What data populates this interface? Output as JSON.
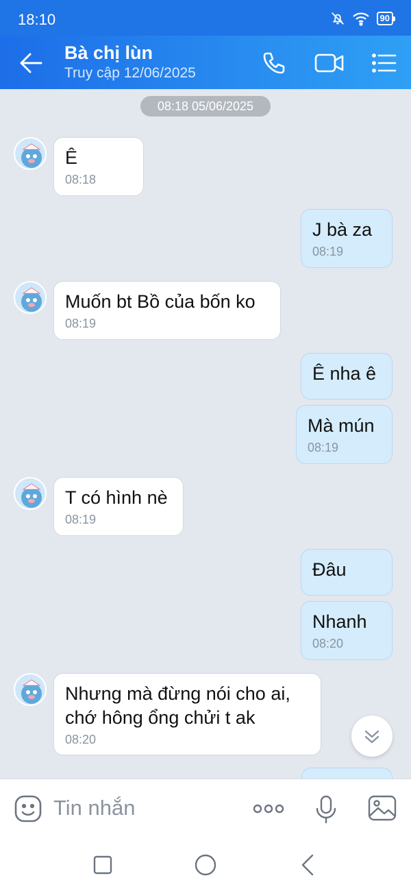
{
  "status_bar": {
    "time": "18:10",
    "battery": "90"
  },
  "header": {
    "title": "Bà chị lùn",
    "subtitle": "Truy cập 12/06/2025"
  },
  "chat": {
    "date_divider": "08:18 05/06/2025",
    "messages": [
      {
        "side": "in",
        "text": "Ê",
        "time": "08:18"
      },
      {
        "side": "out",
        "text": "J bà za",
        "time": "08:19"
      },
      {
        "side": "in",
        "text": "Muốn bt Bồ của bốn ko",
        "time": "08:19"
      },
      {
        "side": "out",
        "text": "Ê nha ê",
        "time": ""
      },
      {
        "side": "out",
        "text": "Mà mún",
        "time": "08:19"
      },
      {
        "side": "in",
        "text": "T có hình nè",
        "time": "08:19"
      },
      {
        "side": "out",
        "text": "Đâu",
        "time": ""
      },
      {
        "side": "out",
        "text": "Nhanh",
        "time": "08:20"
      },
      {
        "side": "in",
        "text": "Nhưng mà đừng nói cho ai,\nchớ hông ổng chửi t ak",
        "time": "08:20"
      }
    ]
  },
  "input": {
    "placeholder": "Tin nhắn"
  },
  "icons": {
    "back": "arrow-left-icon",
    "call": "phone-icon",
    "video": "video-camera-icon",
    "menu": "list-menu-icon",
    "emoji": "emoji-icon",
    "more": "more-dots-icon",
    "mic": "microphone-icon",
    "image": "image-icon",
    "scroll": "chevron-double-down-icon"
  },
  "colors": {
    "header_start": "#1d6ee8",
    "header_end": "#2fa0f5",
    "bubble_out": "#d4ecfc",
    "bubble_in": "#ffffff",
    "chat_bg": "#e3e7ee"
  }
}
